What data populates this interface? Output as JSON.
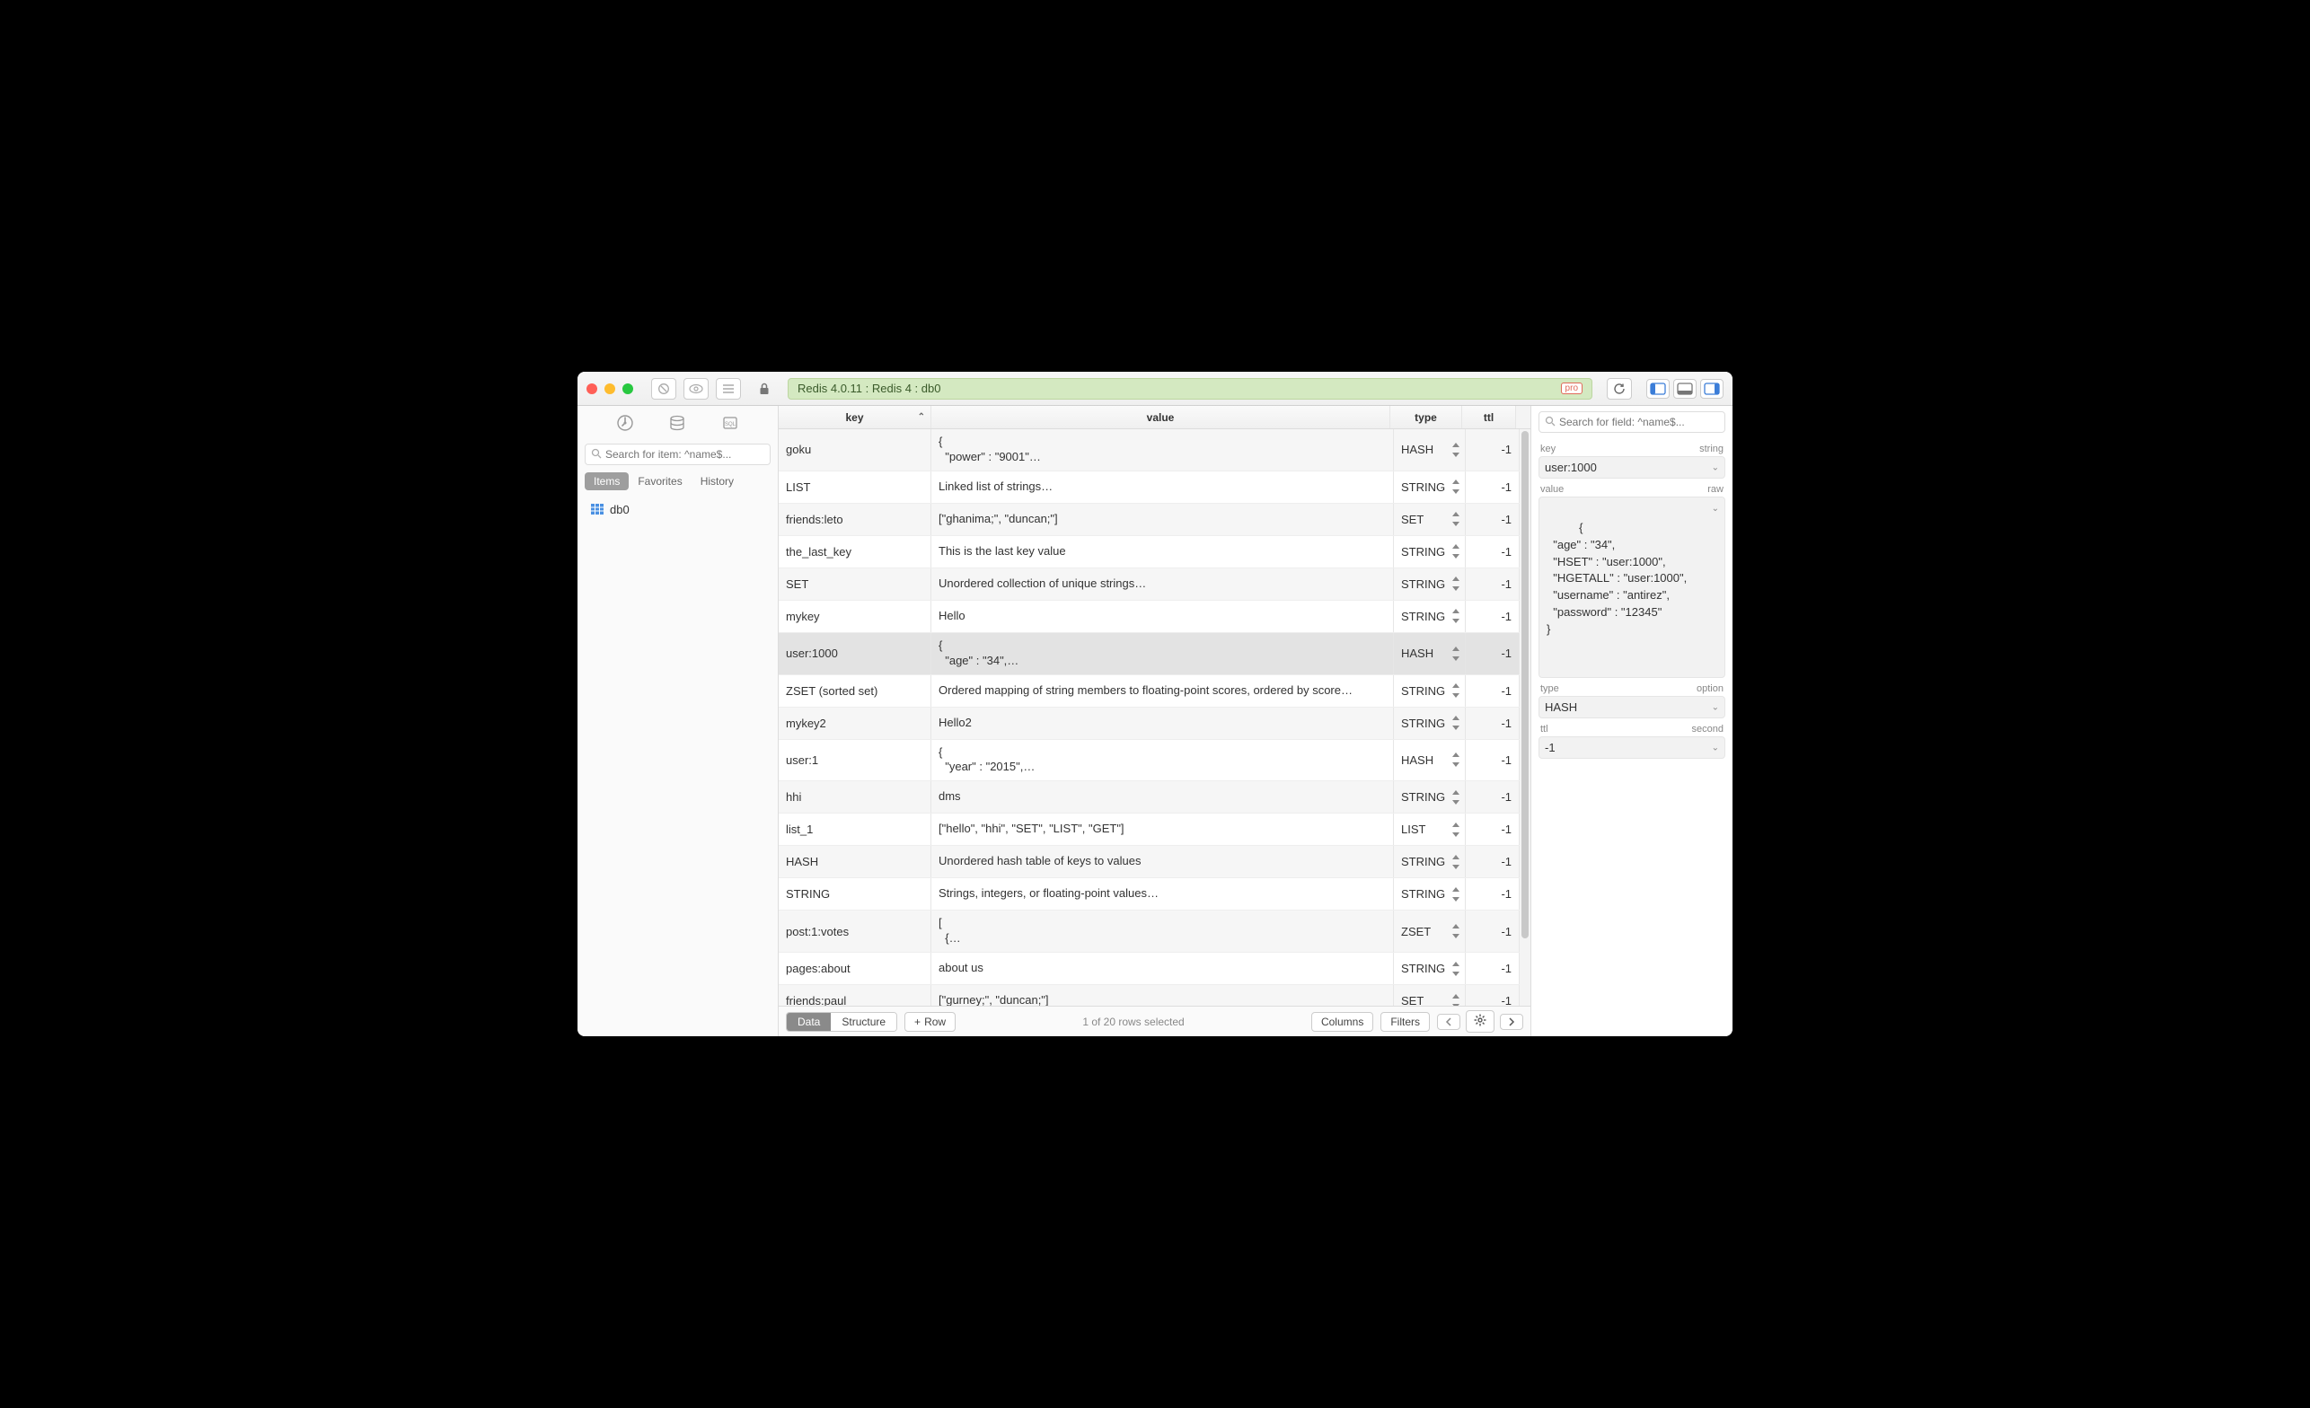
{
  "titlebar": {
    "path": "Redis 4.0.11 : Redis 4 : db0",
    "pro": "pro"
  },
  "sidebar": {
    "search_placeholder": "Search for item: ^name$...",
    "tabs": {
      "items": "Items",
      "favorites": "Favorites",
      "history": "History"
    },
    "tree": {
      "db": "db0"
    }
  },
  "table": {
    "headers": {
      "key": "key",
      "value": "value",
      "type": "type",
      "ttl": "ttl"
    },
    "rows": [
      {
        "key": "goku",
        "value": "{\n  \"power\" : \"9001\"…",
        "type": "HASH",
        "ttl": "-1",
        "selected": false
      },
      {
        "key": "LIST",
        "value": "Linked list of strings…",
        "type": "STRING",
        "ttl": "-1",
        "selected": false
      },
      {
        "key": "friends:leto",
        "value": "[\"ghanima;\", \"duncan;\"]",
        "type": "SET",
        "ttl": "-1",
        "selected": false
      },
      {
        "key": "the_last_key",
        "value": "This is the last key value",
        "type": "STRING",
        "ttl": "-1",
        "selected": false
      },
      {
        "key": "SET",
        "value": "Unordered collection of unique strings…",
        "type": "STRING",
        "ttl": "-1",
        "selected": false
      },
      {
        "key": "mykey",
        "value": "Hello",
        "type": "STRING",
        "ttl": "-1",
        "selected": false
      },
      {
        "key": "user:1000",
        "value": "{\n  \"age\" : \"34\",…",
        "type": "HASH",
        "ttl": "-1",
        "selected": true
      },
      {
        "key": "ZSET (sorted set)",
        "value": "Ordered mapping of string members to floating-point scores, ordered by score…",
        "type": "STRING",
        "ttl": "-1",
        "selected": false
      },
      {
        "key": "mykey2",
        "value": "Hello2",
        "type": "STRING",
        "ttl": "-1",
        "selected": false
      },
      {
        "key": "user:1",
        "value": "{\n  \"year\" : \"2015\",…",
        "type": "HASH",
        "ttl": "-1",
        "selected": false
      },
      {
        "key": "hhi",
        "value": "dms",
        "type": "STRING",
        "ttl": "-1",
        "selected": false
      },
      {
        "key": "list_1",
        "value": "[\"hello\", \"hhi\", \"SET\", \"LIST\", \"GET\"]",
        "type": "LIST",
        "ttl": "-1",
        "selected": false
      },
      {
        "key": "HASH",
        "value": "Unordered hash table of keys to values",
        "type": "STRING",
        "ttl": "-1",
        "selected": false
      },
      {
        "key": "STRING",
        "value": "Strings, integers, or floating-point values…",
        "type": "STRING",
        "ttl": "-1",
        "selected": false
      },
      {
        "key": "post:1:votes",
        "value": "[\n  {…",
        "type": "ZSET",
        "ttl": "-1",
        "selected": false
      },
      {
        "key": "pages:about",
        "value": "about us",
        "type": "STRING",
        "ttl": "-1",
        "selected": false
      },
      {
        "key": "friends:paul",
        "value": "[\"gurney;\", \"duncan;\"]",
        "type": "SET",
        "ttl": "-1",
        "selected": false
      }
    ]
  },
  "footer": {
    "data": "Data",
    "structure": "Structure",
    "add_row": "Row",
    "status": "1 of 20 rows selected",
    "columns": "Columns",
    "filters": "Filters"
  },
  "inspector": {
    "search_placeholder": "Search for field: ^name$...",
    "labels": {
      "key": "key",
      "key_hint": "string",
      "value": "value",
      "value_hint": "raw",
      "type": "type",
      "type_hint": "option",
      "ttl": "ttl",
      "ttl_hint": "second"
    },
    "values": {
      "key": "user:1000",
      "value": "{\n  \"age\" : \"34\",\n  \"HSET\" : \"user:1000\",\n  \"HGETALL\" : \"user:1000\",\n  \"username\" : \"antirez\",\n  \"password\" : \"12345\"\n}",
      "type": "HASH",
      "ttl": "-1"
    }
  }
}
